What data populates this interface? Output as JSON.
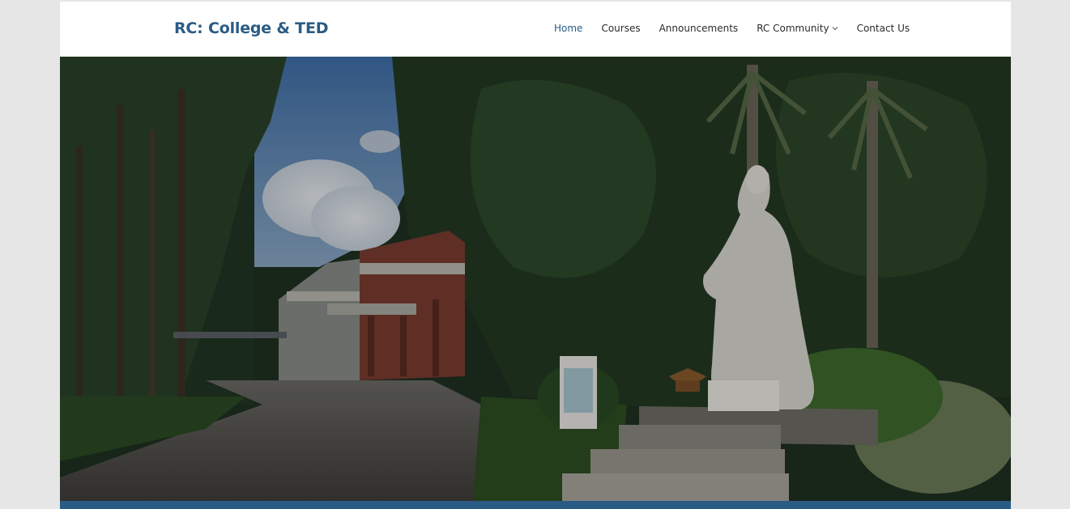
{
  "site": {
    "title": "RC: College & TED"
  },
  "nav": {
    "items": [
      {
        "label": "Home",
        "active": true
      },
      {
        "label": "Courses",
        "active": false
      },
      {
        "label": "Announcements",
        "active": false
      },
      {
        "label": "RC Community",
        "active": false,
        "has_dropdown": true
      },
      {
        "label": "Contact Us",
        "active": false
      }
    ]
  },
  "hero": {
    "image_description": "",
    "icons": {
      "dropdown": "chevron-down-icon"
    }
  },
  "colors": {
    "brand": "#2a5b84",
    "nav_text": "#2b2b2b",
    "page_bg": "#e6e6e6"
  }
}
